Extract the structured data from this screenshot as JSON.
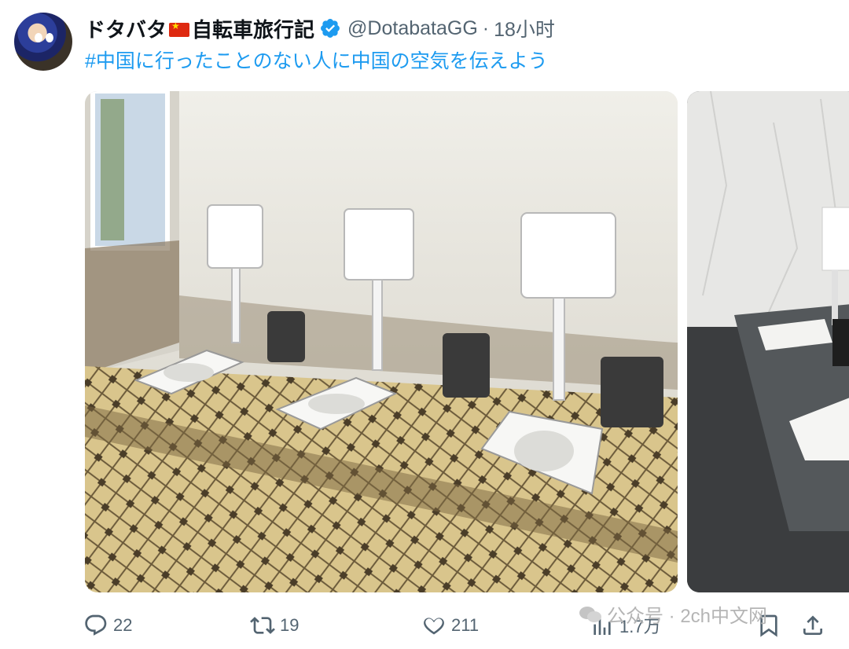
{
  "tweet": {
    "author_name": "ドタバタ",
    "author_name_suffix": "自転車旅行記",
    "handle": "@DotabataGG",
    "separator": "·",
    "time": "18小时",
    "hashtag": "#中国に行ったことのない人に中国の空気を伝えよう"
  },
  "icons": {
    "avatar": "avatar-image",
    "flag": "china-flag-icon",
    "verified": "verified-badge-icon",
    "reply": "reply-icon",
    "retweet": "retweet-icon",
    "like": "heart-icon",
    "views": "views-icon",
    "bookmark": "bookmark-icon",
    "share": "share-icon"
  },
  "actions": {
    "replies": "22",
    "retweets": "19",
    "likes": "211",
    "views": "1.7万"
  },
  "watermark": "公众号 · 2ch中文网",
  "colors": {
    "link": "#1d9bf0",
    "muted": "#536471"
  }
}
